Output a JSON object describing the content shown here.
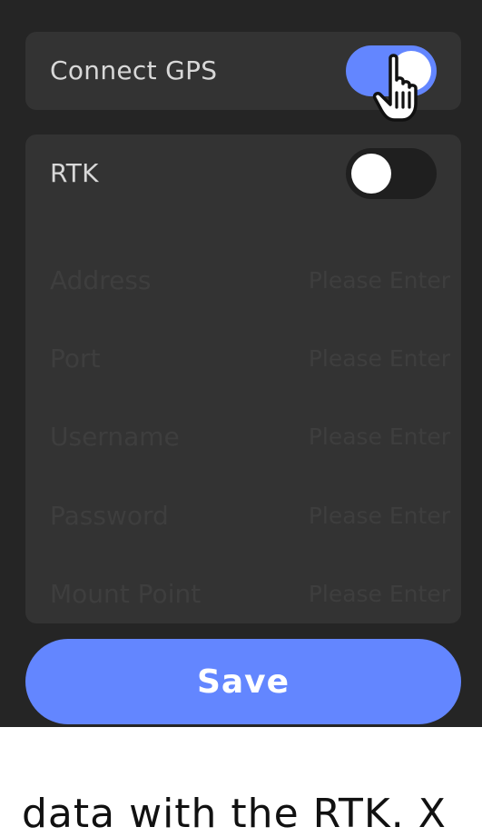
{
  "gps": {
    "label": "Connect GPS",
    "enabled": true
  },
  "rtk": {
    "label": "RTK",
    "enabled": false,
    "fields": [
      {
        "label": "Address",
        "placeholder": "Please Enter"
      },
      {
        "label": "Port",
        "placeholder": "Please Enter"
      },
      {
        "label": "Username",
        "placeholder": "Please Enter"
      },
      {
        "label": "Password",
        "placeholder": "Please Enter"
      },
      {
        "label": "Mount Point",
        "placeholder": "Please Enter"
      }
    ]
  },
  "save_label": "Save",
  "caption_text": "data with the RTK. X",
  "colors": {
    "accent": "#6386ff",
    "panel_bg": "#252525",
    "card_bg": "#333333",
    "disabled_text": "#3e3e3e"
  },
  "icons": {
    "cursor": "hand-pointer-icon"
  }
}
